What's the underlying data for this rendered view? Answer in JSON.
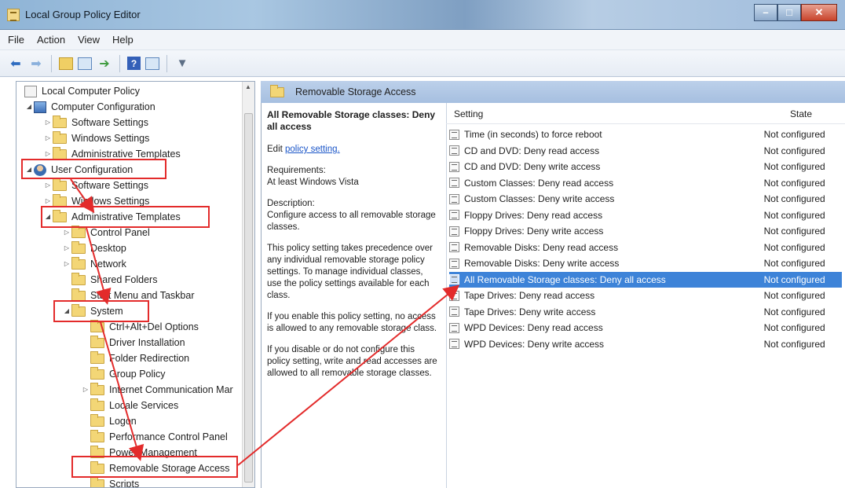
{
  "window": {
    "title": "Local Group Policy Editor"
  },
  "menu": [
    "File",
    "Action",
    "View",
    "Help"
  ],
  "toolbar": {
    "icons": [
      "back-arrow-icon",
      "forward-arrow-icon",
      "up-folder-icon",
      "show-hide-tree-icon",
      "export-list-icon",
      "help-icon",
      "properties-icon",
      "filter-icon"
    ]
  },
  "tree": {
    "items": [
      {
        "label": "Local Computer Policy",
        "icon": "doc"
      },
      {
        "label": "Computer Configuration",
        "icon": "computer"
      },
      {
        "label": "Software Settings",
        "icon": "folder"
      },
      {
        "label": "Windows Settings",
        "icon": "folder"
      },
      {
        "label": "Administrative Templates",
        "icon": "folder"
      },
      {
        "label": "User Configuration",
        "icon": "user"
      },
      {
        "label": "Software Settings",
        "icon": "folder"
      },
      {
        "label": "Windows Settings",
        "icon": "folder"
      },
      {
        "label": "Administrative Templates",
        "icon": "folder"
      },
      {
        "label": "Control Panel",
        "icon": "folder"
      },
      {
        "label": "Desktop",
        "icon": "folder"
      },
      {
        "label": "Network",
        "icon": "folder"
      },
      {
        "label": "Shared Folders",
        "icon": "folder"
      },
      {
        "label": "Start Menu and Taskbar",
        "icon": "folder"
      },
      {
        "label": "System",
        "icon": "folder"
      },
      {
        "label": "Ctrl+Alt+Del Options",
        "icon": "folder"
      },
      {
        "label": "Driver Installation",
        "icon": "folder"
      },
      {
        "label": "Folder Redirection",
        "icon": "folder"
      },
      {
        "label": "Group Policy",
        "icon": "folder"
      },
      {
        "label": "Internet Communication Mar",
        "icon": "folder"
      },
      {
        "label": "Locale Services",
        "icon": "folder"
      },
      {
        "label": "Logon",
        "icon": "folder"
      },
      {
        "label": "Performance Control Panel",
        "icon": "folder"
      },
      {
        "label": "Power Management",
        "icon": "folder"
      },
      {
        "label": "Removable Storage Access",
        "icon": "folder"
      },
      {
        "label": "Scripts",
        "icon": "folder"
      }
    ]
  },
  "panel": {
    "title": "Removable Storage Access"
  },
  "description": {
    "heading": "All Removable Storage classes: Deny all access",
    "edit_prefix": "Edit ",
    "edit_link": "policy setting.",
    "requirements": "Requirements:\nAt least Windows Vista",
    "description": "Description:\nConfigure access to all removable storage classes.",
    "para1": "This policy setting takes precedence over any individual removable storage policy settings. To manage individual classes, use the policy settings available for each class.",
    "para2": "If you enable this policy setting, no access is allowed to any removable storage class.",
    "para3": "If you disable or do not configure this policy setting, write and read accesses are allowed to all removable storage classes."
  },
  "list": {
    "headers": {
      "setting": "Setting",
      "state": "State"
    },
    "rows": [
      {
        "setting": "Time (in seconds) to force reboot",
        "state": "Not configured"
      },
      {
        "setting": "CD and DVD: Deny read access",
        "state": "Not configured"
      },
      {
        "setting": "CD and DVD: Deny write access",
        "state": "Not configured"
      },
      {
        "setting": "Custom Classes: Deny read access",
        "state": "Not configured"
      },
      {
        "setting": "Custom Classes: Deny write access",
        "state": "Not configured"
      },
      {
        "setting": "Floppy Drives: Deny read access",
        "state": "Not configured"
      },
      {
        "setting": "Floppy Drives: Deny write access",
        "state": "Not configured"
      },
      {
        "setting": "Removable Disks: Deny read access",
        "state": "Not configured"
      },
      {
        "setting": "Removable Disks: Deny write access",
        "state": "Not configured"
      },
      {
        "setting": "All Removable Storage classes: Deny all access",
        "state": "Not configured"
      },
      {
        "setting": "Tape Drives: Deny read access",
        "state": "Not configured"
      },
      {
        "setting": "Tape Drives: Deny write access",
        "state": "Not configured"
      },
      {
        "setting": "WPD Devices: Deny read access",
        "state": "Not configured"
      },
      {
        "setting": "WPD Devices: Deny write access",
        "state": "Not configured"
      }
    ],
    "selected_index": 9
  },
  "colors": {
    "selection": "#3d83d8",
    "annotation": "#e32b2b"
  }
}
